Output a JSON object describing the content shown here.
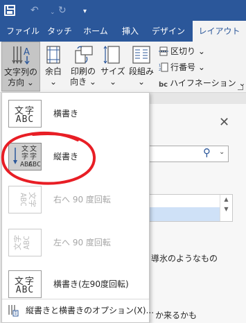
{
  "colors": {
    "accent": "#2b579a",
    "ribbon_bg": "#f3f3f3",
    "annotation": "#e81e25"
  },
  "quick_access": {
    "save_icon": "save-icon",
    "undo_icon": "↶",
    "separator": "⌄",
    "redo_icon": "↻",
    "customize_icon": "▾"
  },
  "tabs": [
    {
      "label": "ファイル",
      "active": false
    },
    {
      "label": "タッチ",
      "active": false
    },
    {
      "label": "ホーム",
      "active": false
    },
    {
      "label": "挿入",
      "active": false
    },
    {
      "label": "デザイン",
      "active": false
    },
    {
      "label": "レイアウト",
      "active": true
    }
  ],
  "ribbon": {
    "text_direction": {
      "line1": "文字列の",
      "line2": "方向 ⌄",
      "icon": "text-direction-icon"
    },
    "margins": {
      "line1": "余白",
      "line2": "⌄",
      "icon": "margins-icon"
    },
    "orientation": {
      "line1": "印刷の",
      "line2": "向き ⌄",
      "icon": "orientation-icon"
    },
    "size": {
      "line1": "サイズ",
      "line2": "⌄",
      "icon": "size-icon"
    },
    "columns": {
      "line1": "段組み",
      "line2": "⌄",
      "icon": "columns-icon"
    },
    "breaks": "区切り ⌄",
    "line_numbers": "行番号 ⌄",
    "hyphenation_icon": "bc",
    "hyphenation": "ハイフネーション ⌄",
    "launcher_icon": "dialog-launcher-icon"
  },
  "menu": {
    "items": [
      {
        "label": "横書き",
        "icon": "horizontal-text-icon",
        "thumb_row1": "文字",
        "thumb_row2": "ABC",
        "enabled": true,
        "selected": false
      },
      {
        "label": "縦書き",
        "icon": "vertical-text-icon",
        "thumb_col1": "文字ABC",
        "thumb_col2": "文字ABC",
        "enabled": true,
        "selected": true
      },
      {
        "label": "右へ 90 度回転",
        "icon": "rotate-right-90-icon",
        "thumb": "文字ABC",
        "enabled": false,
        "selected": false
      },
      {
        "label": "左へ 90 度回転",
        "icon": "rotate-left-90-icon",
        "thumb": "文字ABC",
        "enabled": false,
        "selected": false
      },
      {
        "label": "横書き(左90度回転)",
        "icon": "horizontal-rotated-left-icon",
        "thumb_row1": "文字",
        "thumb_row2": "ABC",
        "enabled": true,
        "selected": false
      }
    ],
    "options_label": "縦書きと横書きのオプション(X)...",
    "options_icon": "text-direction-options-icon"
  },
  "background": {
    "close_icon": "✕",
    "search_icon": "⚲",
    "chevron": "⌄",
    "scroll_up": "▲",
    "scroll_down": "▼",
    "doc_line1": "導氷のようなもの",
    "doc_line2": "か来るかも"
  }
}
